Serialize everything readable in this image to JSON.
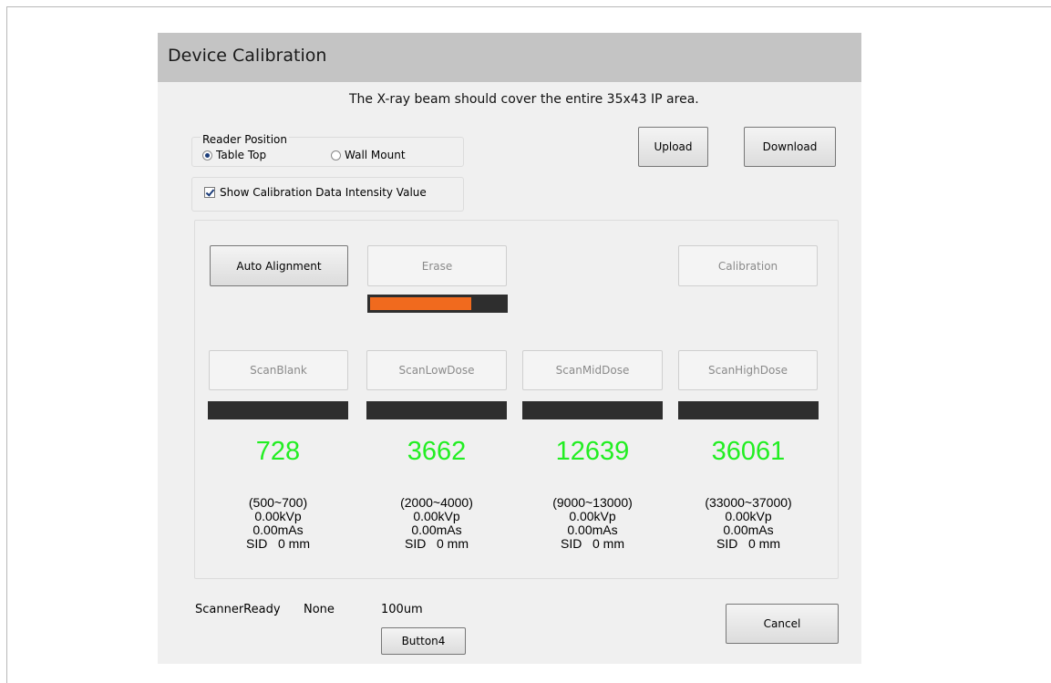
{
  "dialog": {
    "title": "Device Calibration",
    "instruction": "The X-ray beam should cover the entire  35x43 IP area."
  },
  "reader_position": {
    "legend": "Reader Position",
    "options": [
      {
        "label": "Table Top",
        "selected": true
      },
      {
        "label": "Wall Mount",
        "selected": false
      }
    ]
  },
  "show_intensity": {
    "label": "Show Calibration Data Intensity Value",
    "checked": true
  },
  "buttons": {
    "upload": "Upload",
    "download": "Download",
    "auto_alignment": "Auto Alignment",
    "erase": "Erase",
    "calibration": "Calibration",
    "cancel": "Cancel",
    "button4": "Button4"
  },
  "erase_progress": 0.75,
  "colors": {
    "progress_fill": "#f06a1e",
    "value_text": "#22ee22"
  },
  "scans": [
    {
      "label": "ScanBlank",
      "value": "728",
      "range": "(500~700)",
      "kvp": "0.00kVp",
      "mas": "0.00mAs",
      "sid": "SID   0 mm",
      "progress": 0
    },
    {
      "label": "ScanLowDose",
      "value": "3662",
      "range": "(2000~4000)",
      "kvp": "0.00kVp",
      "mas": "0.00mAs",
      "sid": "SID   0 mm",
      "progress": 0
    },
    {
      "label": "ScanMidDose",
      "value": "12639",
      "range": "(9000~13000)",
      "kvp": "0.00kVp",
      "mas": "0.00mAs",
      "sid": "SID   0 mm",
      "progress": 0
    },
    {
      "label": "ScanHighDose",
      "value": "36061",
      "range": "(33000~37000)",
      "kvp": "0.00kVp",
      "mas": "0.00mAs",
      "sid": "SID   0 mm",
      "progress": 0
    }
  ],
  "status": {
    "scanner_state": "ScannerReady",
    "mode": "None",
    "resolution": "100um"
  }
}
